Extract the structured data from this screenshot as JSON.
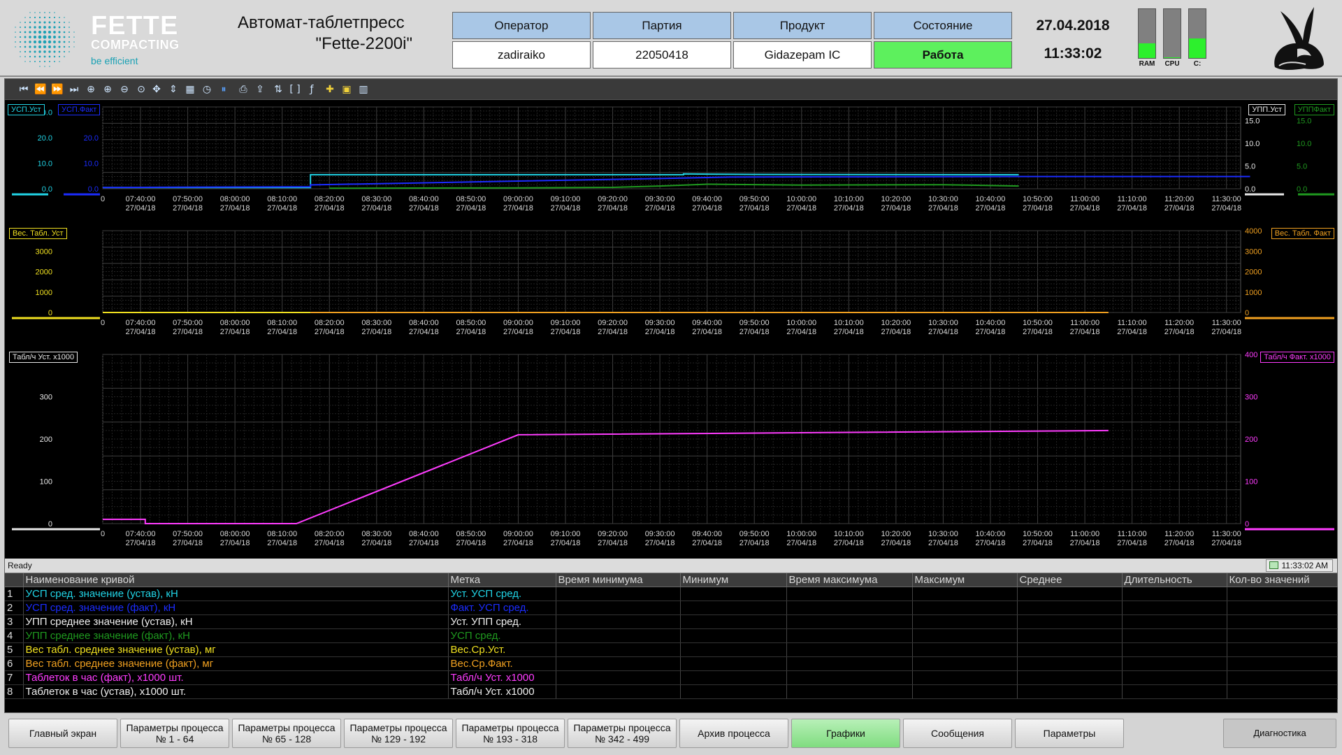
{
  "header": {
    "brand": {
      "name": "FETTE",
      "sub": "COMPACTING",
      "tagline": "be efficient"
    },
    "title_line1": "Автомат-таблетпресс",
    "title_line2": "\"Fette-2200i\"",
    "info": {
      "headers": [
        "Оператор",
        "Партия",
        "Продукт",
        "Состояние"
      ],
      "values": [
        "zadiraiko",
        "22050418",
        "Gidazepam IC",
        "Работа"
      ]
    },
    "date": "27.04.2018",
    "time": "11:33:02",
    "meters": [
      {
        "label": "RAM",
        "level_percent": 30
      },
      {
        "label": "CPU",
        "level_percent": 2
      },
      {
        "label": "C:",
        "level_percent": 40
      }
    ],
    "colors": {
      "state_ok": "#5df05d",
      "header_cell": "#a9c7e6",
      "meter_fill": "#2df02d"
    }
  },
  "toolbar": {
    "icons": [
      "first-icon",
      "prev-icon",
      "next-icon",
      "last-icon",
      "zoom-fit-icon",
      "zoom-in-icon",
      "zoom-out-icon",
      "zoom-icon",
      "pan-icon",
      "axis-icon",
      "grid-icon",
      "clock-icon",
      "pause-icon",
      "print-icon",
      "export-icon",
      "cursor-icon",
      "bracket-icon",
      "fx-icon",
      "add-icon",
      "folder-icon",
      "settings-icon"
    ]
  },
  "time_axis": {
    "ticks": [
      "07:40:00",
      "07:50:00",
      "08:00:00",
      "08:10:00",
      "08:20:00",
      "08:30:00",
      "08:40:00",
      "08:50:00",
      "09:00:00",
      "09:10:00",
      "09:20:00",
      "09:30:00",
      "09:40:00",
      "09:50:00",
      "10:00:00",
      "10:10:00",
      "10:20:00",
      "10:30:00",
      "10:40:00",
      "10:50:00",
      "11:00:00",
      "11:10:00",
      "11:20:00",
      "11:30:00"
    ],
    "date": "27/04/18"
  },
  "chart_data": [
    {
      "type": "line",
      "left_axis": {
        "ticks": [
          "0.0",
          "10.0",
          "20.0",
          "30.0"
        ],
        "ylim": [
          0,
          32
        ]
      },
      "right_axis": {
        "ticks": [
          "0.0",
          "5.0",
          "10.0",
          "15.0"
        ],
        "ylim": [
          0,
          18
        ]
      },
      "legend_left": [
        {
          "label": "УСП.Уст",
          "color": "#21d4e6"
        },
        {
          "label": "УСП.Факт",
          "color": "#1b2cff"
        }
      ],
      "legend_right": [
        {
          "label": "УПП.Уст",
          "color": "#e8e8e8"
        },
        {
          "label": "УППФакт",
          "color": "#1f9a1f"
        }
      ],
      "series": [
        {
          "name": "УСП.Уст",
          "axis": "left",
          "color": "#21d4e6",
          "x": [
            "07:32",
            "08:16",
            "08:16",
            "09:35",
            "09:35",
            "09:50",
            "10:46"
          ],
          "values": [
            0.5,
            0.5,
            5.5,
            5.5,
            5.8,
            5.6,
            5.5
          ]
        },
        {
          "name": "УСП.Факт",
          "axis": "left",
          "color": "#1b2cff",
          "x": [
            "07:32",
            "08:16",
            "08:16",
            "09:00",
            "09:30",
            "09:45",
            "10:46",
            "11:35"
          ],
          "values": [
            0.5,
            0.8,
            1.5,
            3.0,
            4.0,
            4.6,
            4.8,
            4.8
          ]
        },
        {
          "name": "УППФакт",
          "axis": "right",
          "color": "#1f9a1f",
          "x": [
            "08:20",
            "09:00",
            "09:20",
            "09:30",
            "09:40",
            "10:00",
            "10:30",
            "10:46"
          ],
          "values": [
            0.1,
            0.2,
            0.3,
            0.6,
            1.0,
            0.8,
            0.9,
            0.6
          ]
        }
      ]
    },
    {
      "type": "line",
      "left_axis": {
        "ticks": [
          "0",
          "1000",
          "2000",
          "3000",
          "4000"
        ],
        "ylim": [
          0,
          4000
        ]
      },
      "right_axis": {
        "ticks": [
          "0",
          "1000",
          "2000",
          "3000",
          "4000"
        ],
        "ylim": [
          0,
          4000
        ]
      },
      "legend_left": [
        {
          "label": "Вес. Табл. Уст",
          "color": "#f0e020"
        }
      ],
      "legend_right": [
        {
          "label": "Вес. Табл. Факт",
          "color": "#f0a020"
        }
      ],
      "series": [
        {
          "name": "Вес. Табл. Уст",
          "axis": "left",
          "color": "#f0e020",
          "x": [
            "07:32",
            "08:16"
          ],
          "values": [
            0,
            0
          ]
        },
        {
          "name": "Вес. Табл. Факт",
          "axis": "right",
          "color": "#f0a020",
          "x": [
            "08:16",
            "11:05"
          ],
          "values": [
            0,
            0
          ]
        }
      ]
    },
    {
      "type": "line",
      "left_axis": {
        "ticks": [
          "0",
          "100",
          "200",
          "300",
          "400"
        ],
        "ylim": [
          0,
          400
        ]
      },
      "right_axis": {
        "ticks": [
          "0",
          "100",
          "200",
          "300",
          "400"
        ],
        "ylim": [
          0,
          400
        ]
      },
      "legend_left": [
        {
          "label": "Табл/ч Уст. х1000",
          "color": "#e8e8e8"
        }
      ],
      "legend_right": [
        {
          "label": "Табл/ч Факт. х1000",
          "color": "#ff3cff"
        }
      ],
      "series": [
        {
          "name": "Табл/ч Факт. х1000",
          "axis": "right",
          "color": "#ff3cff",
          "x": [
            "07:32",
            "07:41",
            "07:41",
            "08:13",
            "09:00",
            "11:05"
          ],
          "values": [
            10,
            10,
            0,
            0,
            210,
            220
          ]
        }
      ]
    }
  ],
  "status_bar": {
    "text": "Ready",
    "time": "11:33:02 AM"
  },
  "curve_table": {
    "columns": [
      "Наименование кривой",
      "Метка",
      "Время минимума",
      "Минимум",
      "Время максимума",
      "Максимум",
      "Среднее",
      "Длительность",
      "Кол-во значений"
    ],
    "rows": [
      {
        "idx": "1",
        "name": "УСП сред. значение (устав), кН",
        "tag": "Уст. УСП сред.",
        "color": "#21d4e6"
      },
      {
        "idx": "2",
        "name": "УСП сред. значение (факт), кН",
        "tag": "Факт. УСП сред.",
        "color": "#1b2cff"
      },
      {
        "idx": "3",
        "name": "УПП среднее значение (устав), кН",
        "tag": "Уст. УПП сред.",
        "color": "#f0f0f0"
      },
      {
        "idx": "4",
        "name": "УПП среднее значение (факт), кН",
        "tag": "УСП сред.",
        "color": "#1f9a1f"
      },
      {
        "idx": "5",
        "name": "Вес табл. среднее значение (устав), мг",
        "tag": "Вес.Ср.Уст.",
        "color": "#f0e020"
      },
      {
        "idx": "6",
        "name": "Вес табл. среднее значение (факт), мг",
        "tag": "Вес.Ср.Факт.",
        "color": "#f0a020"
      },
      {
        "idx": "7",
        "name": "Таблеток в час (факт), х1000 шт.",
        "tag": "Табл/ч Уст. х1000",
        "color": "#ff3cff"
      },
      {
        "idx": "8",
        "name": "Таблеток в час (устав), х1000 шт.",
        "tag": "Табл/ч Уст. х1000",
        "color": "#f0f0f0"
      }
    ]
  },
  "nav": [
    {
      "label1": "Главный экран",
      "label2": ""
    },
    {
      "label1": "Параметры процесса",
      "label2": "№ 1 - 64"
    },
    {
      "label1": "Параметры процесса",
      "label2": "№ 65 - 128"
    },
    {
      "label1": "Параметры процесса",
      "label2": "№ 129 - 192"
    },
    {
      "label1": "Параметры процесса",
      "label2": "№ 193 - 318"
    },
    {
      "label1": "Параметры процесса",
      "label2": "№ 342 - 499"
    },
    {
      "label1": "Архив процесса",
      "label2": ""
    },
    {
      "label1": "Графики",
      "label2": ""
    },
    {
      "label1": "Сообщения",
      "label2": ""
    },
    {
      "label1": "Параметры",
      "label2": ""
    },
    {
      "label1": "Диагностика",
      "label2": ""
    }
  ],
  "nav_active": "Графики"
}
